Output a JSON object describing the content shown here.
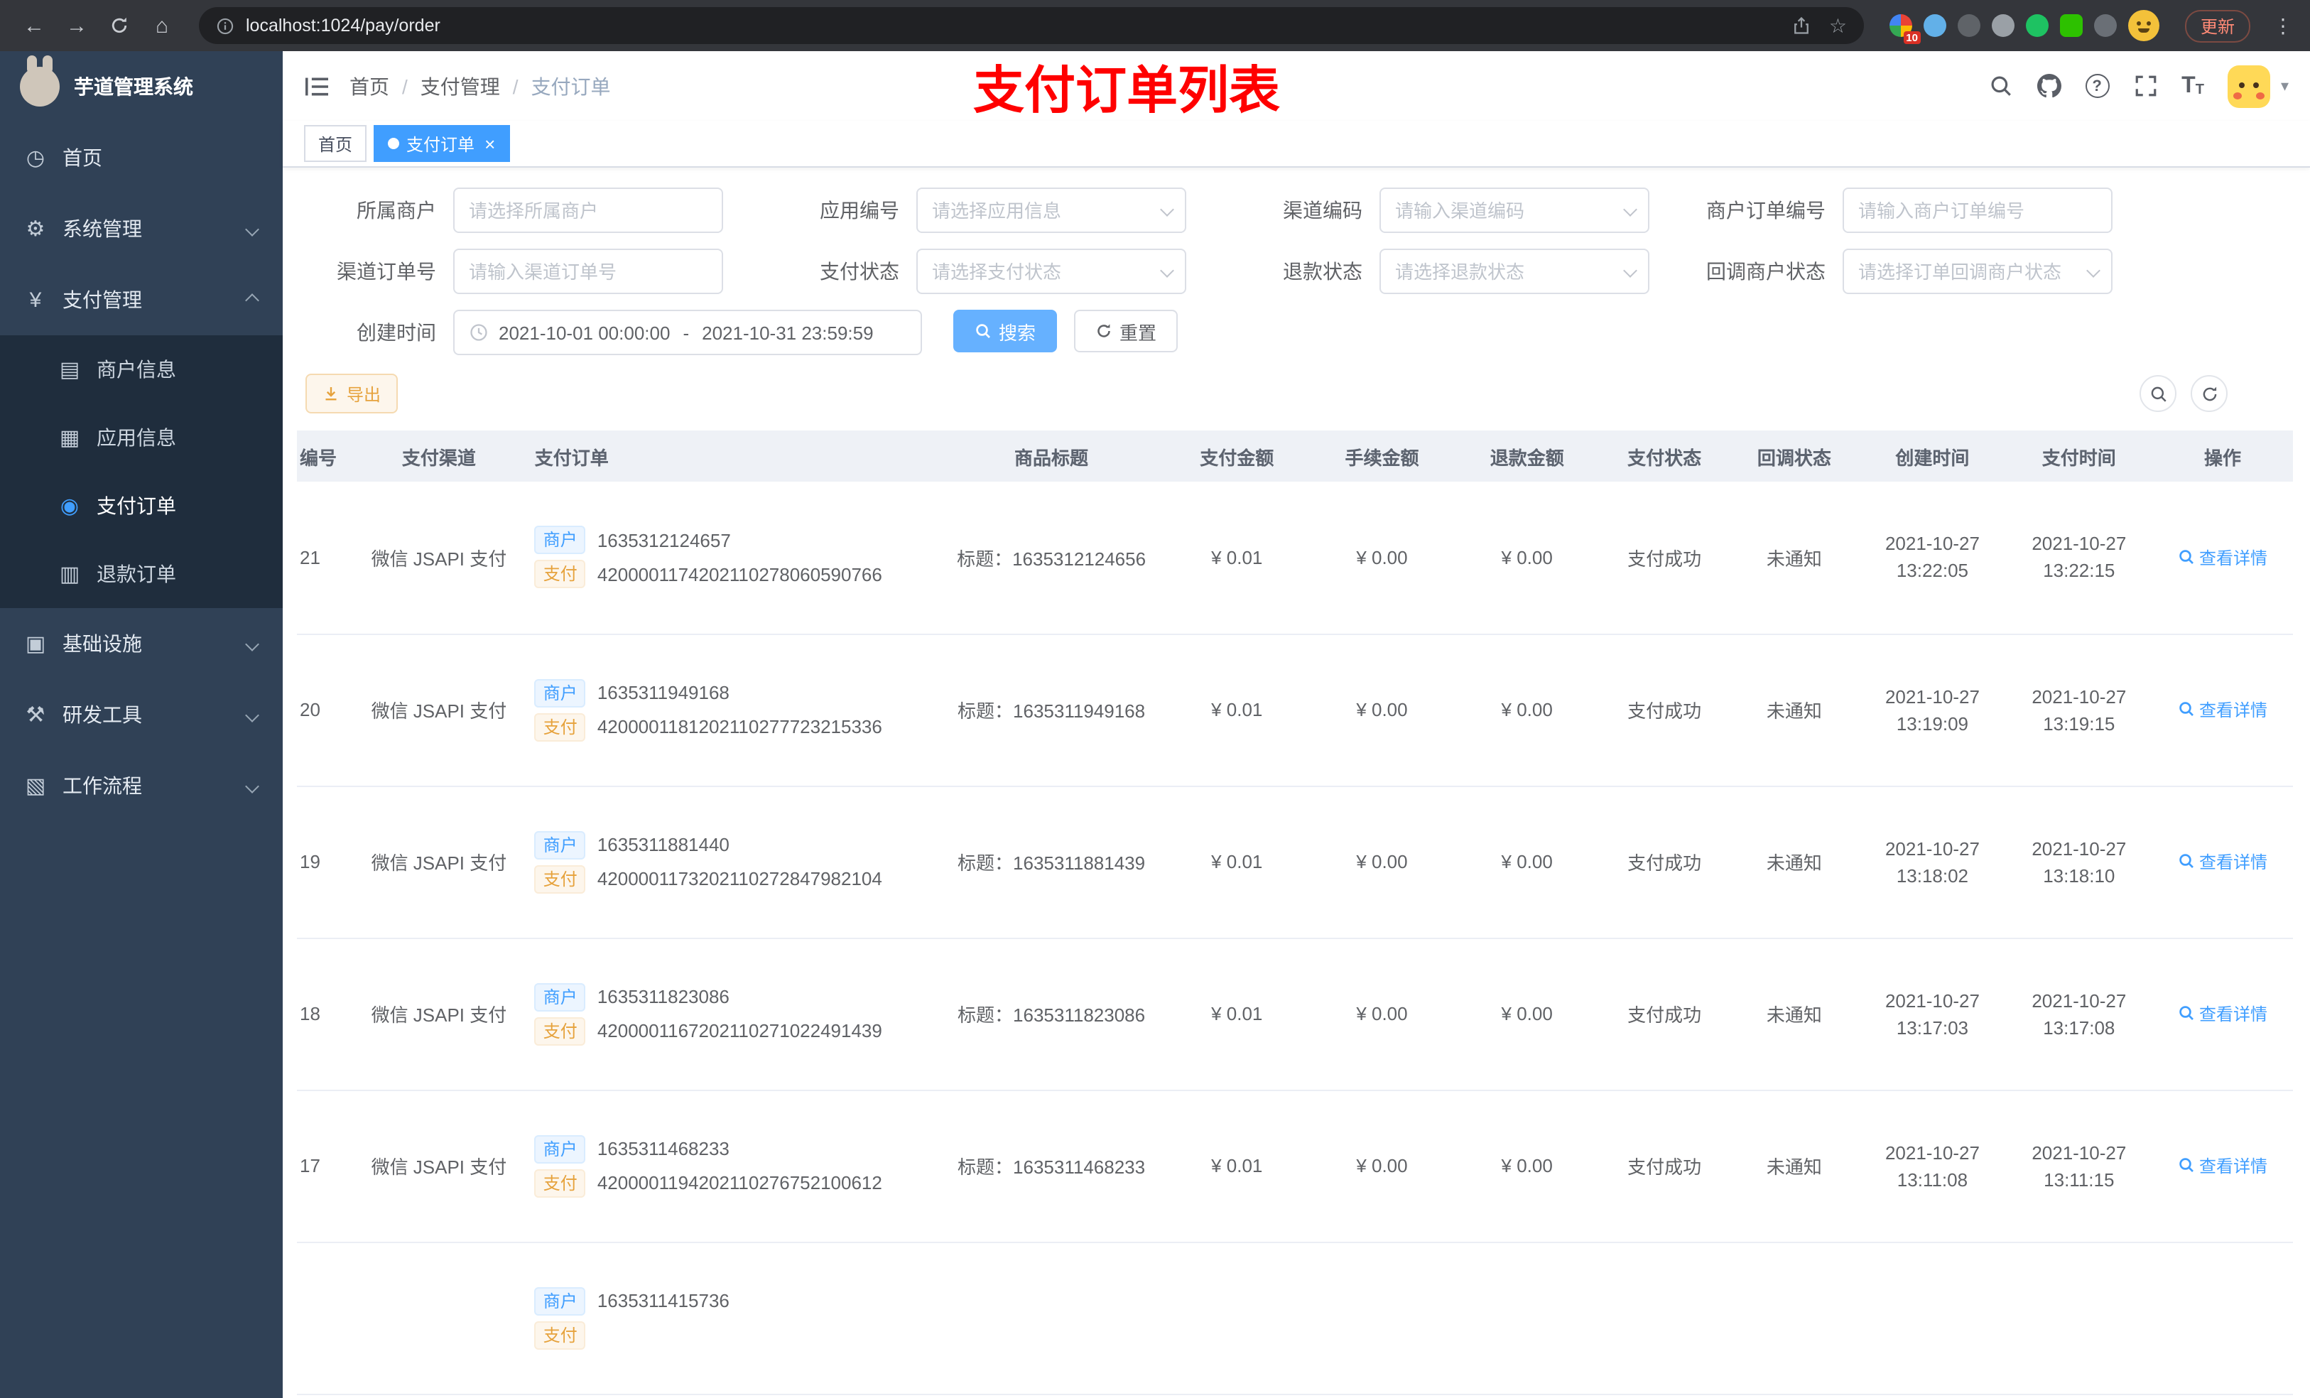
{
  "browser": {
    "url": "localhost:1024/pay/order",
    "extension_badge": "10",
    "update_label": "更新"
  },
  "glyphs": {
    "back": "←",
    "forward": "→",
    "home": "⌂",
    "star": "☆",
    "more": "⋮",
    "caret": "▾",
    "close": "×",
    "slash": "/",
    "question": "?",
    "font_large": "T",
    "font_small": "T",
    "dashboard": "◷",
    "gear": "⚙",
    "yen": "¥",
    "card": "▤",
    "grid": "▦",
    "record": "◉",
    "doc": "▥",
    "monitor": "▣",
    "tools": "⚒",
    "flow": "▧"
  },
  "sidebar": {
    "logo_title": "芋道管理系统",
    "items": [
      {
        "label": "首页"
      },
      {
        "label": "系统管理"
      },
      {
        "label": "支付管理"
      },
      {
        "label": "基础设施"
      },
      {
        "label": "研发工具"
      },
      {
        "label": "工作流程"
      }
    ],
    "submenu": [
      {
        "label": "商户信息"
      },
      {
        "label": "应用信息"
      },
      {
        "label": "支付订单"
      },
      {
        "label": "退款订单"
      }
    ]
  },
  "header": {
    "breadcrumb": [
      "首页",
      "支付管理",
      "支付订单"
    ],
    "annotation": "支付订单列表"
  },
  "tabs": [
    {
      "label": "首页"
    },
    {
      "label": "支付订单"
    }
  ],
  "filters": {
    "fields": [
      {
        "label": "所属商户",
        "placeholder": "请选择所属商户"
      },
      {
        "label": "应用编号",
        "placeholder": "请选择应用信息"
      },
      {
        "label": "渠道编码",
        "placeholder": "请输入渠道编码"
      },
      {
        "label": "商户订单编号",
        "placeholder": "请输入商户订单编号"
      },
      {
        "label": "渠道订单号",
        "placeholder": "请输入渠道订单号"
      },
      {
        "label": "支付状态",
        "placeholder": "请选择支付状态"
      },
      {
        "label": "退款状态",
        "placeholder": "请选择退款状态"
      },
      {
        "label": "回调商户状态",
        "placeholder": "请选择订单回调商户状态"
      }
    ],
    "date_label": "创建时间",
    "date_start": "2021-10-01 00:00:00",
    "date_separator": "-",
    "date_end": "2021-10-31 23:59:59",
    "search_label": "搜索",
    "reset_label": "重置"
  },
  "toolbar": {
    "export_label": "导出"
  },
  "table": {
    "tags": {
      "merchant": "商户",
      "pay": "支付"
    },
    "columns": [
      "编号",
      "支付渠道",
      "支付订单",
      "商品标题",
      "支付金额",
      "手续金额",
      "退款金额",
      "支付状态",
      "回调状态",
      "创建时间",
      "支付时间",
      "操作"
    ],
    "rows": [
      {
        "id": "21",
        "channel": "微信 JSAPI 支付",
        "merchant_no": "1635312124657",
        "pay_no": "4200001174202110278060590766",
        "title": "标题：1635312124656",
        "amount": "¥ 0.01",
        "fee": "¥ 0.00",
        "refund": "¥ 0.00",
        "status": "支付成功",
        "notify": "未通知",
        "create_date": "2021-10-27",
        "create_time": "13:22:05",
        "pay_date": "2021-10-27",
        "pay_time": "13:22:15",
        "action": "查看详情"
      },
      {
        "id": "20",
        "channel": "微信 JSAPI 支付",
        "merchant_no": "1635311949168",
        "pay_no": "4200001181202110277723215336",
        "title": "标题：1635311949168",
        "amount": "¥ 0.01",
        "fee": "¥ 0.00",
        "refund": "¥ 0.00",
        "status": "支付成功",
        "notify": "未通知",
        "create_date": "2021-10-27",
        "create_time": "13:19:09",
        "pay_date": "2021-10-27",
        "pay_time": "13:19:15",
        "action": "查看详情"
      },
      {
        "id": "19",
        "channel": "微信 JSAPI 支付",
        "merchant_no": "1635311881440",
        "pay_no": "4200001173202110272847982104",
        "title": "标题：1635311881439",
        "amount": "¥ 0.01",
        "fee": "¥ 0.00",
        "refund": "¥ 0.00",
        "status": "支付成功",
        "notify": "未通知",
        "create_date": "2021-10-27",
        "create_time": "13:18:02",
        "pay_date": "2021-10-27",
        "pay_time": "13:18:10",
        "action": "查看详情"
      },
      {
        "id": "18",
        "channel": "微信 JSAPI 支付",
        "merchant_no": "1635311823086",
        "pay_no": "4200001167202110271022491439",
        "title": "标题：1635311823086",
        "amount": "¥ 0.01",
        "fee": "¥ 0.00",
        "refund": "¥ 0.00",
        "status": "支付成功",
        "notify": "未通知",
        "create_date": "2021-10-27",
        "create_time": "13:17:03",
        "pay_date": "2021-10-27",
        "pay_time": "13:17:08",
        "action": "查看详情"
      },
      {
        "id": "17",
        "channel": "微信 JSAPI 支付",
        "merchant_no": "1635311468233",
        "pay_no": "4200001194202110276752100612",
        "title": "标题：1635311468233",
        "amount": "¥ 0.01",
        "fee": "¥ 0.00",
        "refund": "¥ 0.00",
        "status": "支付成功",
        "notify": "未通知",
        "create_date": "2021-10-27",
        "create_time": "13:11:08",
        "pay_date": "2021-10-27",
        "pay_time": "13:11:15",
        "action": "查看详情"
      },
      {
        "merchant_no": "1635311415736"
      }
    ]
  }
}
